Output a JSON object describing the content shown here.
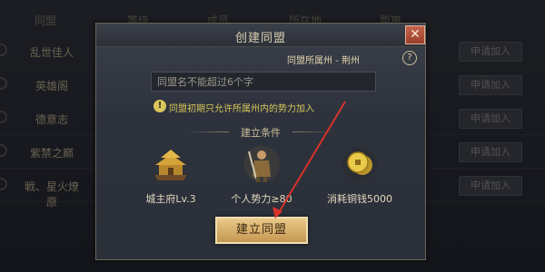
{
  "background": {
    "headers": [
      "同盟",
      "等级",
      "成员",
      "所在地",
      "距离"
    ],
    "rows": [
      {
        "name": "乱世佳人",
        "join": "申请加入"
      },
      {
        "name": "英雄阁",
        "join": "申请加入"
      },
      {
        "name": "德意志",
        "join": "申请加入"
      },
      {
        "name": "紫禁之巅",
        "join": "申请加入"
      },
      {
        "name": "戦、星火燎原",
        "join": "申请加入"
      }
    ]
  },
  "dialog": {
    "title": "创建同盟",
    "close_label": "✕",
    "affiliation": "同盟所属州 - 荆州",
    "help_label": "?",
    "name_placeholder": "同盟名不能超过6个字",
    "warning_icon": "!",
    "warning_text": "同盟初期只允许所属州内的势力加入",
    "conditions_title": "建立条件",
    "conditions": [
      {
        "icon": "palace-icon",
        "label": "城主府Lv.3"
      },
      {
        "icon": "warrior-icon",
        "label": "个人势力≥80"
      },
      {
        "icon": "copper-coin-icon",
        "label": "消耗铜钱5000"
      }
    ],
    "create_label": "建立同盟"
  },
  "colors": {
    "accent_gold": "#e9c98a",
    "warning_yellow": "#d9c65a",
    "arrow_red": "#d8322c"
  }
}
